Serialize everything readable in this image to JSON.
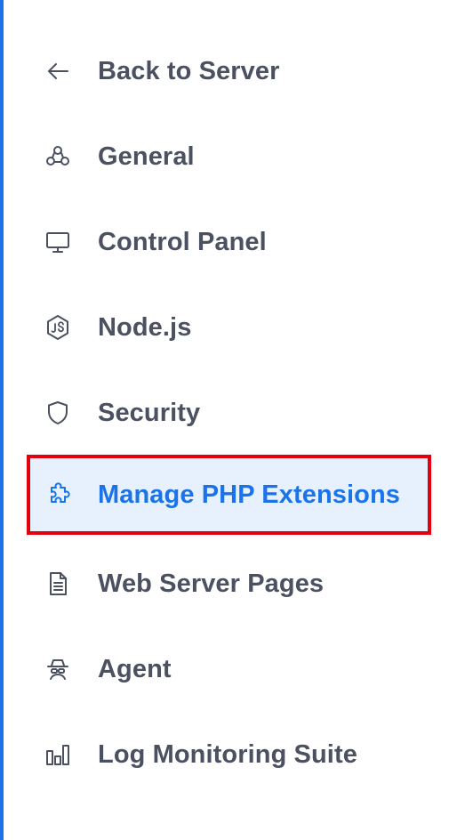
{
  "sidebar": {
    "items": [
      {
        "label": "Back to Server",
        "icon": "arrow-left-icon",
        "active": false
      },
      {
        "label": "General",
        "icon": "nodes-icon",
        "active": false
      },
      {
        "label": "Control Panel",
        "icon": "monitor-icon",
        "active": false
      },
      {
        "label": "Node.js",
        "icon": "nodejs-icon",
        "active": false
      },
      {
        "label": "Security",
        "icon": "shield-icon",
        "active": false
      },
      {
        "label": "Manage PHP Extensions",
        "icon": "puzzle-icon",
        "active": true
      },
      {
        "label": "Web Server Pages",
        "icon": "document-icon",
        "active": false
      },
      {
        "label": "Agent",
        "icon": "agent-icon",
        "active": false
      },
      {
        "label": "Log Monitoring Suite",
        "icon": "bar-chart-icon",
        "active": false
      }
    ]
  },
  "colors": {
    "accent": "#1a73e8",
    "text": "#4b5160",
    "active_bg": "#e7f0fd",
    "highlight_border": "#e3000f"
  }
}
